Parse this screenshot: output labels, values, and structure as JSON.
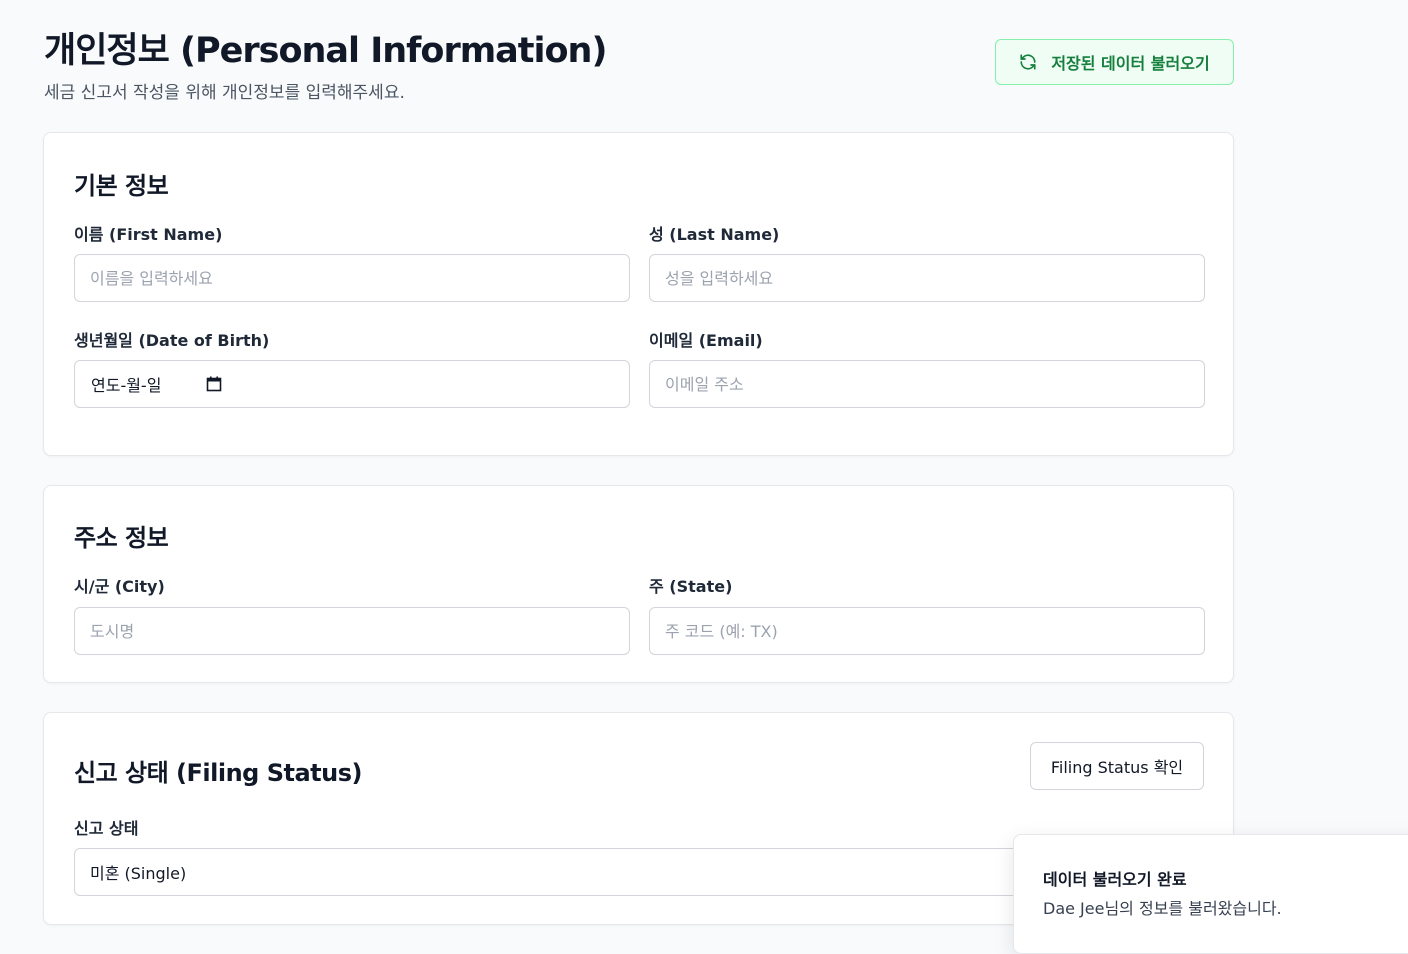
{
  "header": {
    "title": "개인정보 (Personal Information)",
    "subtitle": "세금 신고서 작성을 위해 개인정보를 입력해주세요.",
    "load_button_label": "저장된 데이터 불러오기",
    "load_button_icon": "refresh-icon",
    "accent_color": "#15803d"
  },
  "basic_info": {
    "title": "기본 정보",
    "first_name": {
      "label": "이름 (First Name)",
      "placeholder": "이름을 입력하세요",
      "value": ""
    },
    "last_name": {
      "label": "성 (Last Name)",
      "placeholder": "성을 입력하세요",
      "value": ""
    },
    "dob": {
      "label": "생년월일 (Date of Birth)",
      "display": "연도-월-일",
      "icon": "calendar-icon"
    },
    "email": {
      "label": "이메일 (Email)",
      "placeholder": "이메일 주소",
      "value": ""
    }
  },
  "address_info": {
    "title": "주소 정보",
    "city": {
      "label": "시/군 (City)",
      "placeholder": "도시명",
      "value": ""
    },
    "state": {
      "label": "주 (State)",
      "placeholder": "주 코드 (예: TX)",
      "value": ""
    }
  },
  "filing_status": {
    "title": "신고 상태 (Filing Status)",
    "check_button_label": "Filing Status 확인",
    "field_label": "신고 상태",
    "selected_value": "미혼 (Single)"
  },
  "toast": {
    "title": "데이터 불러오기 완료",
    "message": "Dae Jee님의 정보를 불러왔습니다."
  }
}
